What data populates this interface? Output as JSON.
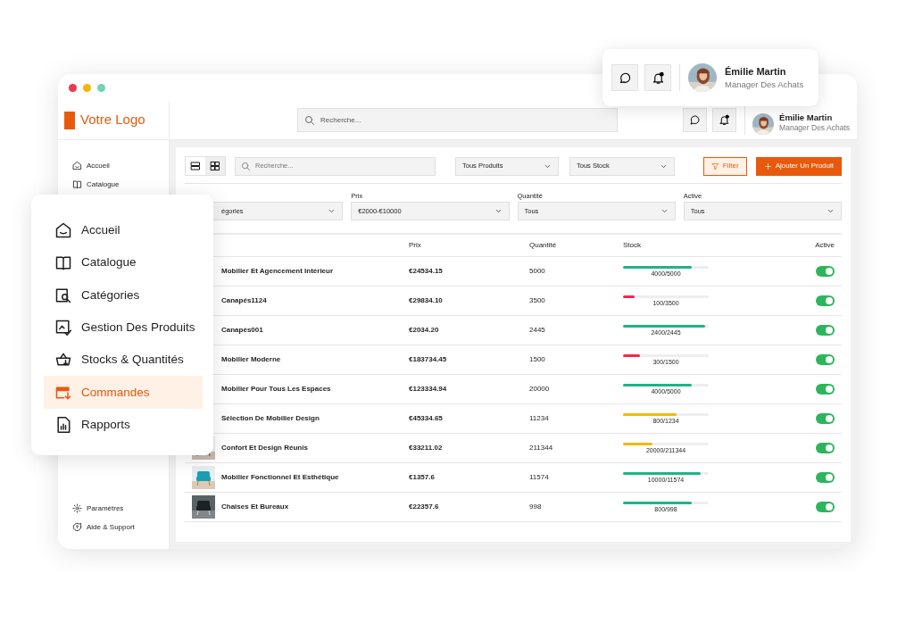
{
  "window": {
    "logo": "Votre Logo"
  },
  "sidebar": {
    "items": [
      {
        "label": "Accueil"
      },
      {
        "label": "Catalogue"
      }
    ],
    "footer": [
      {
        "label": "Paramètres"
      },
      {
        "label": "Aide & Support"
      }
    ]
  },
  "header": {
    "search": {
      "placeholder": "Recherche..."
    },
    "user": {
      "name": "Émilie Martin",
      "role": "Manager Des Achats"
    }
  },
  "toolbar": {
    "views": [
      {
        "selected": false
      },
      {
        "selected": true
      }
    ],
    "search": {
      "placeholder": "Recherche..."
    },
    "selects": [
      "Tous Produits",
      "Tous Stock"
    ],
    "filter_button": "Filter",
    "add_button": "Ajouter Un Produit"
  },
  "filters": [
    {
      "value": "égories"
    },
    {
      "label": "Prix",
      "value": "€2000-€10000"
    },
    {
      "label": "Quantité",
      "value": "Tous"
    },
    {
      "label": "Active",
      "value": "Tous"
    }
  ],
  "table": {
    "columns": [
      "Prix",
      "Quantité",
      "Stock",
      "Active"
    ],
    "rows": [
      {
        "name": "Mobilier Et Agencement Intérieur",
        "price": "€24534.15",
        "quantity": "5000",
        "stock": {
          "level": 0.8,
          "reading": "4000/5000",
          "color": "#1db48a"
        },
        "on": true
      },
      {
        "name": "Canapés1124",
        "price": "€29834.10",
        "quantity": "3500",
        "stock": {
          "level": 0.14,
          "reading": "100/3500",
          "color": "#f0284a"
        },
        "on": true
      },
      {
        "name": "Canapés001",
        "price": "€2034.20",
        "quantity": "2445",
        "stock": {
          "level": 0.96,
          "reading": "2400/2445",
          "color": "#1db48a"
        },
        "on": true
      },
      {
        "name": "Mobilier Moderne",
        "price": "€183734.45",
        "quantity": "1500",
        "stock": {
          "level": 0.2,
          "reading": "300/1500",
          "color": "#f0284a"
        },
        "on": true
      },
      {
        "name": "Mobilier Pour Tous Les Espaces",
        "price": "€123334.94",
        "quantity": "20000",
        "stock": {
          "level": 0.8,
          "reading": "4000/5000",
          "color": "#1db48a"
        },
        "on": true
      },
      {
        "name": "Sélection De Mobilier Design",
        "price": "€45334.65",
        "quantity": "11234",
        "stock": {
          "level": 0.62,
          "reading": "800/1234",
          "color": "#f5b800"
        },
        "on": true
      },
      {
        "name": "Confort Et Design Réunis",
        "price": "€33211.02",
        "quantity": "211344",
        "stock": {
          "level": 0.34,
          "reading": "20000/211344",
          "color": "#f5b800"
        },
        "on": true
      },
      {
        "name": "Mobilier Fonctionnel Et Esthétique",
        "price": "€1357.6",
        "quantity": "11574",
        "stock": {
          "level": 0.91,
          "reading": "10000/11574",
          "color": "#1db48a"
        },
        "on": true
      },
      {
        "name": "Chaises Et Bureaux",
        "price": "€22357.6",
        "quantity": "998",
        "stock": {
          "level": 0.8,
          "reading": "800/998",
          "color": "#1db48a"
        },
        "on": true
      }
    ]
  },
  "menu_card": {
    "items": [
      {
        "label": "Accueil",
        "selected": false
      },
      {
        "label": "Catalogue",
        "selected": false
      },
      {
        "label": "Catégories",
        "selected": false
      },
      {
        "label": "Gestion Des Produits",
        "selected": false
      },
      {
        "label": "Stocks & Quantités",
        "selected": false
      },
      {
        "label": "Commandes",
        "selected": true
      },
      {
        "label": "Rapports",
        "selected": false
      }
    ]
  },
  "user_card": {
    "name": "Émilie Martin",
    "role": "Manager Des Achats"
  }
}
